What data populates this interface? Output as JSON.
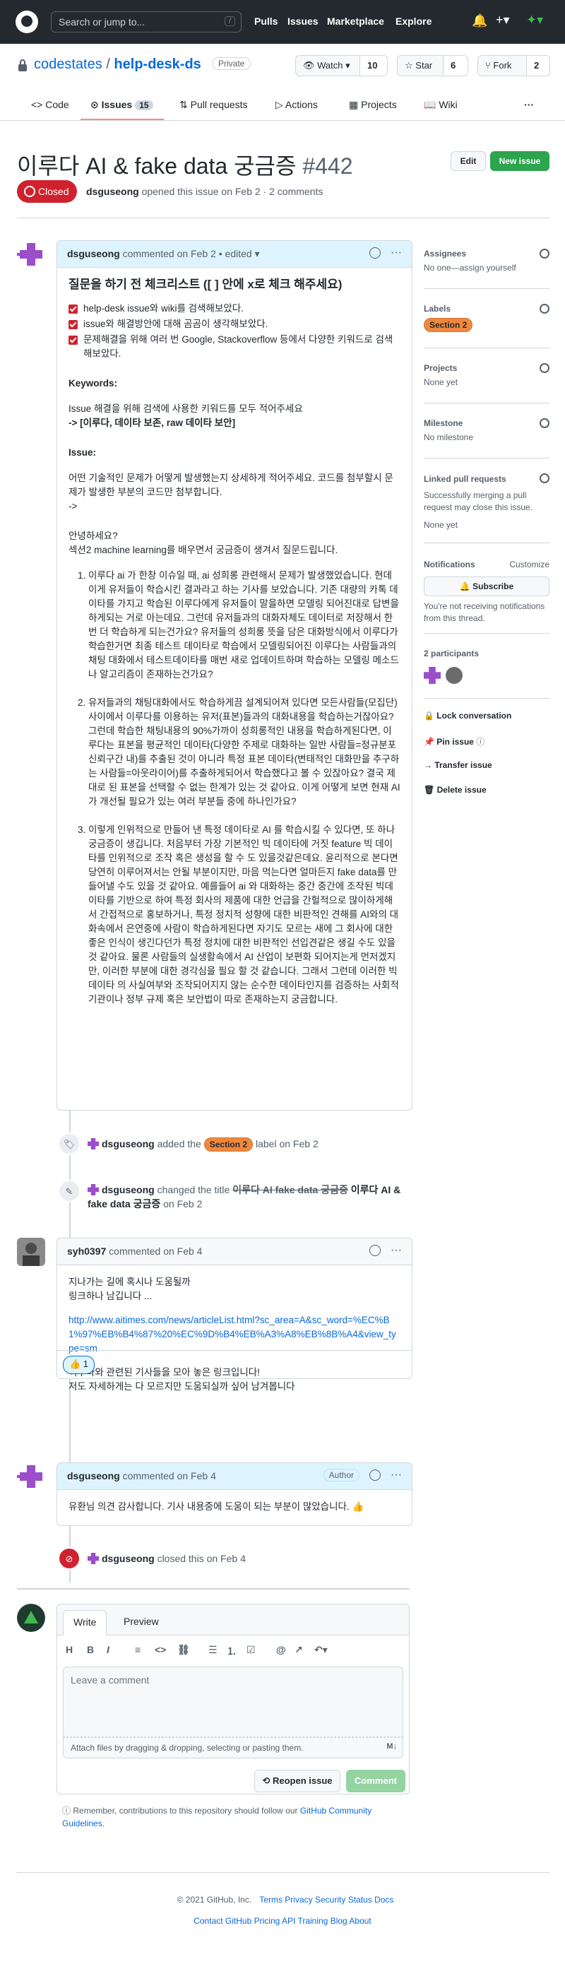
{
  "header": {
    "search_placeholder": "Search or jump to...",
    "search_shortcut": "/",
    "nav": [
      "Pulls",
      "Issues",
      "Marketplace",
      "Explore"
    ]
  },
  "repo": {
    "owner": "codestates",
    "separator": "/",
    "name": "help-desk-ds",
    "visibility": "Private",
    "watch_label": "Watch",
    "watch_count": "10",
    "star_label": "Star",
    "star_count": "6",
    "fork_label": "Fork",
    "fork_count": "2"
  },
  "tabs": [
    {
      "label": "Code"
    },
    {
      "label": "Issues",
      "count": "15"
    },
    {
      "label": "Pull requests"
    },
    {
      "label": "Actions"
    },
    {
      "label": "Projects"
    },
    {
      "label": "Wiki"
    },
    {
      "label": "···"
    }
  ],
  "issue": {
    "title": "이루다 AI & fake data 궁금증",
    "number": "#442",
    "edit_label": "Edit",
    "new_issue_label": "New issue",
    "state": "Closed",
    "author": "dsguseong",
    "meta": "opened this issue on Feb 2 · 2 comments"
  },
  "comment1": {
    "author": "dsguseong",
    "meta": "commented on Feb 2 • edited ▾",
    "heading": "질문을 하기 전 체크리스트 ([ ] 안에 x로 체크 해주세요)",
    "checklist": [
      "help-desk issue와 wiki를 검색해보았다.",
      "issue와 해결방안에 대해 곰곰이 생각해보았다.",
      "문제해결을 위해 여러 번 Google, Stackoverflow 등에서 다양한 키워드로 검색해보았다."
    ],
    "keywords_title": "Keywords:",
    "keywords_desc": "Issue 해결을 위해 검색에 사용한 키워드를 모두 적어주세요",
    "keywords_value": "-> [이루다, 데이타 보존, raw 데이타 보안]",
    "issue_title": "Issue:",
    "issue_desc": "어떤 기술적인 문제가 어떻게 발생했는지 상세하게 적어주세요. 코드를 첨부할시 문제가 발생한 부분의 코드만 첨부합니다.",
    "issue_arrow": "->",
    "greeting1": "안녕하세요?",
    "greeting2": "섹션2 machine learning를 배우면서 궁금증이 생겨서 질문드립니다.",
    "items": [
      "이루다 ai 가 한창 이슈일 때, ai 성희롱 관련해서 문제가 발생했었습니다. 현데 이게 유저들이 학습시킨 결과라고 하는 기사를 보았습니다. 기존 대량의 카톡 데이타를 가지고 학습된 이루다에게 유저들이 말을하면 모델링 되어진대로 답변을 하게되는 거로 아는데요. 그런데 유저들과의 대화자체도 데이터로 저장해서 한번 더 학습하게 되는건가요? 유저들의 성희롱 뜻을 담은 대화방식에서 이루다가 학습한거면 최종 테스트 데이타로 학습에서 모델링되어진 이루다는 사람들과의 채팅 대화에서 테스트데이타를 매번 새로 업데이트하며 학습하는 모델링 메소드나 알고리즘이 존재하는건가요?",
      "유저들과의 채팅대화에서도 학습하게끔 설계되어져 있다면 모든사람들(모집단) 사이에서 이루다를 이용하는 유저(표본)들과의 대화내용을 학습하는거잖아요? 그런데 학습한 채팅내용의 90%가까이 성희롱적인 내용을 학습하게된다면, 이루다는 표본을 평균적인 데이타(다양한 주제로 대화하는 일반 사람들=정규분포 신뢰구간 내)를 추출된 것이 아니라 특정 표본 데이타(변태적인 대화만을 추구하는 사람들=아웃라이어)를 추출하게되어서 학습했다고 볼 수 있잖아요? 결국 제대로 된 표본을 선택할 수 없는 한계가 있는 것 같아요. 이게 어떻게 보면 현재 AI 가 개선될 필요가 있는 여러 부분들 중에 하나인가요?",
      "이렇게 인위적으로 만들어 낸 특정 데이타로 AI 를 학습시킬 수 있다면, 또 하나 궁금증이 생깁니다. 처음부터 가장 기본적인 빅 데이타에 거짓 feature 빅 데이타를 인위적으로 조작 혹은 생성을 할 수 도 있을것같은데요. 윤리적으로 본다면 당연히 이루어져서는 안될 부분이지만, 마음 먹는다면 얼마든지 fake data를 만들어낼 수도 있을 것 같아요. 예를들어 ai 와 대화하는 중간 중간에 조작된 빅데이타를 기반으로 하여 특정 회사의 제품에 대한 언급을 간헐적으로 많이하게해서 간접적으로 홍보하거나, 특정 정치적 성향에 대한 비판적인 견해를 AI와의 대화속에서 은연중에 사람이 학습하게된다면 자기도 모르는 새에 그 회사에 대한 좋은 인식이 생긴다던가 특정 정치에 대한 비판적인 선입견같은 생길 수도 있을 것 같아요. 물론 사람들의 실생활속에서 AI 산업이 보편화 되어지는게 먼저겠지만, 이러한 부분에 대한 경각심을 필요 할 것 같습니다. 그래서 그런데 이러한 빅데이타 의 사실여부와 조작되어지지 않는 순수한 데이타인지를 검증하는 사회적 기관이나 정부 규제 혹은 보안법이 따로 존재하는지 궁금합니다."
    ]
  },
  "event_label": {
    "actor": "dsguseong",
    "before": "added the",
    "label": "Section 2",
    "after": "label on Feb 2"
  },
  "event_title": {
    "actor": "dsguseong",
    "before": "changed the title",
    "old_title": "이루다 AI fake data 궁금증",
    "new_title": "이루다 AI & fake data 궁금증",
    "after": "on Feb 2"
  },
  "comment2": {
    "author": "syh0397",
    "meta": "commented on Feb 4",
    "line1": "지나가는 길에 혹시나 도움될까",
    "line2": "링크하나 남깁니다 ...",
    "link": "http://www.aitimes.com/news/articleList.html?sc_area=A&sc_word=%EC%B1%97%EB%B4%87%20%EC%9D%B4%EB%A3%A8%EB%8B%A4&view_type=sm",
    "line3": "이루다와 관련된 기사들을 모아 놓은 링크입니다!",
    "line4": "저도 자세하게는 다 모르지만 도움되실까 싶어 남겨봅니다",
    "reaction": "👍 1"
  },
  "comment3": {
    "author": "dsguseong",
    "meta": "commented on Feb 4",
    "badge": "Author",
    "body": "유환님 의견 감사합니다. 기사 내용중에 도움이 되는 부분이 많았습니다. 👍"
  },
  "event_closed": {
    "actor": "dsguseong",
    "text": "closed this on Feb 4"
  },
  "editor": {
    "tab_write": "Write",
    "tab_preview": "Preview",
    "placeholder": "Leave a comment",
    "attach_text": "Attach files by dragging & dropping, selecting or pasting them.",
    "reopen_label": "Reopen issue",
    "comment_label": "Comment",
    "guidelines_text": "Remember, contributions to this repository should follow our",
    "guidelines_link": "GitHub Community Guidelines",
    "guidelines_end": "."
  },
  "sidebar": {
    "assignees_title": "Assignees",
    "assignees_value": "No one—assign yourself",
    "labels_title": "Labels",
    "label_value": "Section 2",
    "projects_title": "Projects",
    "projects_value": "None yet",
    "milestone_title": "Milestone",
    "milestone_value": "No milestone",
    "linked_title": "Linked pull requests",
    "linked_desc": "Successfully merging a pull request may close this issue.",
    "linked_value": "None yet",
    "notifications_title": "Notifications",
    "customize": "Customize",
    "subscribe": "Subscribe",
    "notif_desc": "You're not receiving notifications from this thread.",
    "participants": "2 participants",
    "actions": [
      "Lock conversation",
      "Pin issue",
      "Transfer issue",
      "Delete issue"
    ]
  },
  "footer": {
    "row1": [
      "© 2021 GitHub, Inc.",
      "Terms",
      "Privacy",
      "Security",
      "Status",
      "Docs"
    ],
    "row2": [
      "Contact GitHub",
      "Pricing",
      "API",
      "Training",
      "Blog",
      "About"
    ]
  },
  "colors": {
    "header_bg": "#24292f",
    "closed": "#cf222e",
    "primary_green": "#2da44e",
    "link": "#0969da",
    "label_section2": "#f0883e"
  }
}
